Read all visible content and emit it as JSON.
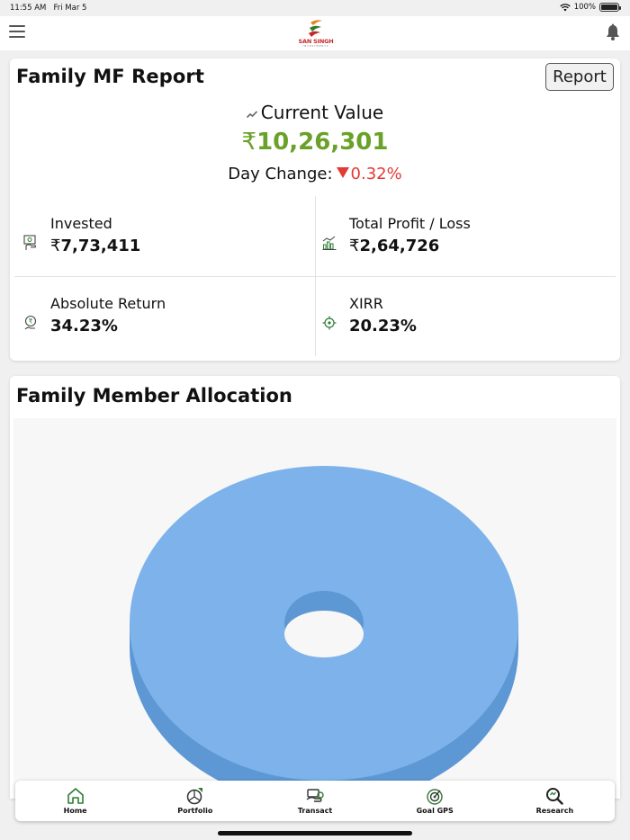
{
  "status_bar": {
    "time": "11:55 AM",
    "date": "Fri Mar 5",
    "battery": "100%"
  },
  "header": {
    "logo_text": "SAN SINGH",
    "logo_subtext": "INVESTMENTS",
    "menu_icon": "hamburger-icon",
    "notification_icon": "bell-icon"
  },
  "report": {
    "title": "Family MF Report",
    "report_button": "Report",
    "current_value_label": "Current Value",
    "currency_symbol": "₹",
    "current_value": "10,26,301",
    "day_change_label": "Day Change:",
    "day_change_value": "0.32%",
    "stats": {
      "invested": {
        "label": "Invested",
        "value": "7,73,411",
        "icon": "invest-icon"
      },
      "profit": {
        "label": "Total Profit / Loss",
        "value": "2,64,726",
        "icon": "bar-chart-icon"
      },
      "absolute": {
        "label": "Absolute Return",
        "value": "34.23%",
        "icon": "rupee-hand-icon"
      },
      "xirr": {
        "label": "XIRR",
        "value": "20.23%",
        "icon": "target-icon"
      }
    }
  },
  "allocation": {
    "title": "Family Member Allocation"
  },
  "chart_data": {
    "type": "pie",
    "variant": "3d-donut",
    "title": "",
    "slices": [
      {
        "label": "",
        "value": 100,
        "color": "#7db3ea"
      }
    ]
  },
  "nav": {
    "items": [
      {
        "label": "Home",
        "icon": "home-icon"
      },
      {
        "label": "Portfolio",
        "icon": "portfolio-icon"
      },
      {
        "label": "Transact",
        "icon": "transact-icon"
      },
      {
        "label": "Goal GPS",
        "icon": "goal-gps-icon"
      },
      {
        "label": "Research",
        "icon": "research-icon"
      }
    ]
  },
  "colors": {
    "positive": "#6aa128",
    "negative": "#e53935",
    "chart_top": "#7db3ea",
    "chart_side": "#5e98d4",
    "accent_green": "#2e7d32"
  }
}
